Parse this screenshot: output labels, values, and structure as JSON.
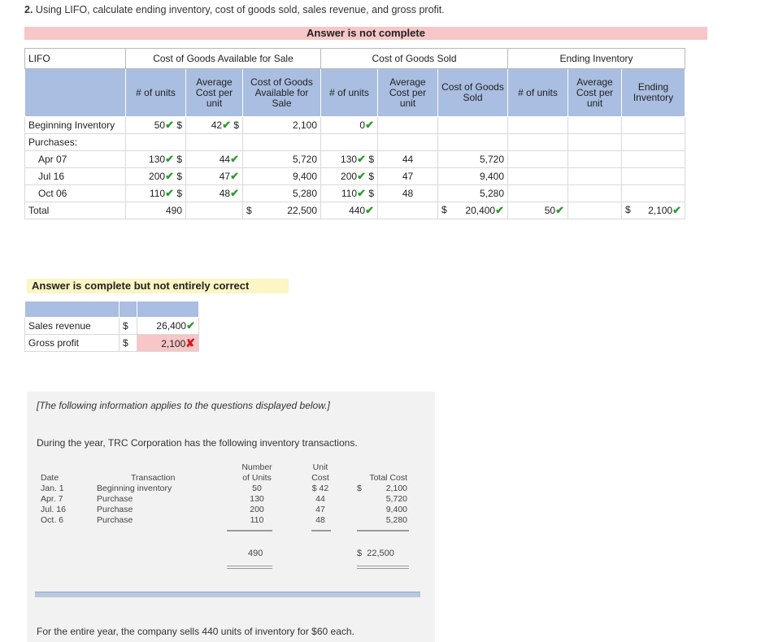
{
  "question": {
    "number": "2.",
    "text": "Using LIFO, calculate ending inventory, cost of goods sold, sales revenue, and gross profit."
  },
  "banner_incomplete": "Answer is not complete",
  "lifo": {
    "corner_label": "LIFO",
    "groups": {
      "available": "Cost of Goods Available for Sale",
      "cogs": "Cost of Goods Sold",
      "ending": "Ending Inventory"
    },
    "subheaders": {
      "units": "# of units",
      "avg_cost": "Average Cost per unit",
      "cost_available": "Cost of Goods Available for Sale",
      "cogs": "Cost of Goods Sold",
      "ending_inventory": "Ending Inventory"
    },
    "rows": {
      "beginning": {
        "label": "Beginning Inventory",
        "units": "50",
        "avg": "42",
        "cost": "2,100",
        "cogs_units": "0"
      },
      "purchases": {
        "label": "Purchases:"
      },
      "apr": {
        "label": "Apr 07",
        "units": "130",
        "avg": "44",
        "cost": "5,720",
        "cogs_units": "130",
        "cogs_avg": "44",
        "cogs_cost": "5,720"
      },
      "jul": {
        "label": "Jul 16",
        "units": "200",
        "avg": "47",
        "cost": "9,400",
        "cogs_units": "200",
        "cogs_avg": "47",
        "cogs_cost": "9,400"
      },
      "oct": {
        "label": "Oct 06",
        "units": "110",
        "avg": "48",
        "cost": "5,280",
        "cogs_units": "110",
        "cogs_avg": "48",
        "cogs_cost": "5,280"
      },
      "total": {
        "label": "Total",
        "units": "490",
        "cost": "22,500",
        "cogs_units": "440",
        "cogs_cost": "20,400",
        "end_units": "50",
        "end_cost": "2,100"
      }
    },
    "dollar": "$"
  },
  "banner_partial": "Answer is complete but not entirely correct",
  "sales": {
    "revenue_label": "Sales revenue",
    "revenue_value": "26,400",
    "profit_label": "Gross profit",
    "profit_value": "2,100",
    "dollar": "$"
  },
  "info": {
    "note": "[The following information applies to the questions displayed below.]",
    "during": "During  the year, TRC Corporation has the following inventory transactions.",
    "headers": {
      "date": "Date",
      "transaction": "Transaction",
      "number": "Number",
      "of_units": "of Units",
      "unit": "Unit",
      "cost": "Cost",
      "total_cost": "Total Cost"
    },
    "rows": [
      {
        "date": "Jan. 1",
        "transaction": "Beginning inventory",
        "units": "50",
        "cost": "$ 42",
        "total": "2,100"
      },
      {
        "date": "Apr. 7",
        "transaction": "Purchase",
        "units": "130",
        "cost": "44",
        "total": "5,720"
      },
      {
        "date": "Jul. 16",
        "transaction": "Purchase",
        "units": "200",
        "cost": "47",
        "total": "9,400"
      },
      {
        "date": "Oct. 6",
        "transaction": "Purchase",
        "units": "110",
        "cost": "48",
        "total": "5,280"
      }
    ],
    "total_units": "490",
    "total_cost": "22,500",
    "dollar": "$",
    "final": "For the entire year, the company sells 440 units of inventory for $60 each."
  },
  "icons": {
    "check": "check-icon",
    "wrong": "x-icon"
  },
  "colors": {
    "check": "#2e9c2e",
    "wrong": "#d11c1c",
    "header_blue": "#a9bee0",
    "banner_red": "#f7c6c7",
    "banner_yellow": "#fbf6c3"
  }
}
